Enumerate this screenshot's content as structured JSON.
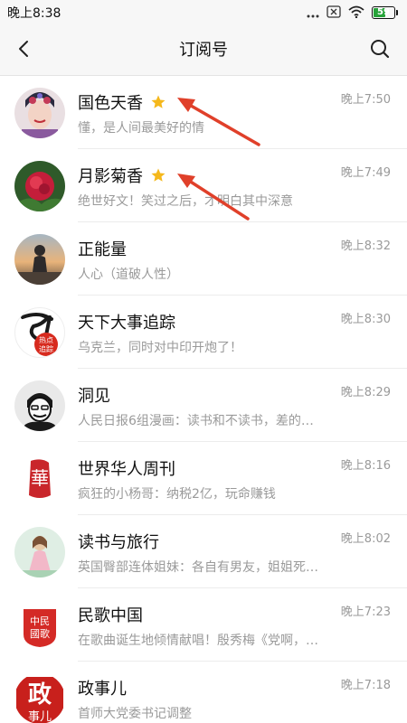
{
  "status_bar": {
    "time": "晚上8:38",
    "battery": "59",
    "icons": [
      "dots-icon",
      "close-box-icon",
      "wifi-icon",
      "battery-icon"
    ]
  },
  "header": {
    "title": "订阅号",
    "back_icon": "chevron-left-icon",
    "search_icon": "search-icon"
  },
  "items": [
    {
      "name": "国色天香",
      "preview": "懂，是人间最美好的情",
      "time": "晚上7:50",
      "starred": true
    },
    {
      "name": "月影菊香",
      "preview": "绝世好文！笑过之后，才明白其中深意",
      "time": "晚上7:49",
      "starred": true
    },
    {
      "name": "正能量",
      "preview": "人心（道破人性）",
      "time": "晚上8:32",
      "starred": false
    },
    {
      "name": "天下大事追踪",
      "preview": "乌克兰，同时对中印开炮了！",
      "time": "晚上8:30",
      "starred": false,
      "avatar_text": [
        "热点",
        "追踪"
      ]
    },
    {
      "name": "洞见",
      "preview": "人民日报6组漫画：读书和不读书，差的…",
      "time": "晚上8:29",
      "starred": false
    },
    {
      "name": "世界华人周刊",
      "preview": "疯狂的小杨哥：纳税2亿，玩命赚钱",
      "time": "晚上8:16",
      "starred": false,
      "avatar_text": [
        "華"
      ]
    },
    {
      "name": "读书与旅行",
      "preview": "英国臀部连体姐妹：各自有男友，姐姐死…",
      "time": "晚上8:02",
      "starred": false
    },
    {
      "name": "民歌中国",
      "preview": "在歌曲诞生地倾情献唱！殷秀梅《党啊，…",
      "time": "晚上7:23",
      "starred": false,
      "avatar_text": [
        "中民",
        "國歌"
      ]
    },
    {
      "name": "政事儿",
      "preview": "首师大党委书记调整",
      "time": "晚上7:18",
      "starred": false,
      "avatar_text": [
        "政",
        "事儿"
      ]
    }
  ],
  "colors": {
    "star": "#f5b81c",
    "arrow": "#e0402a",
    "battery": "#27a33a"
  }
}
